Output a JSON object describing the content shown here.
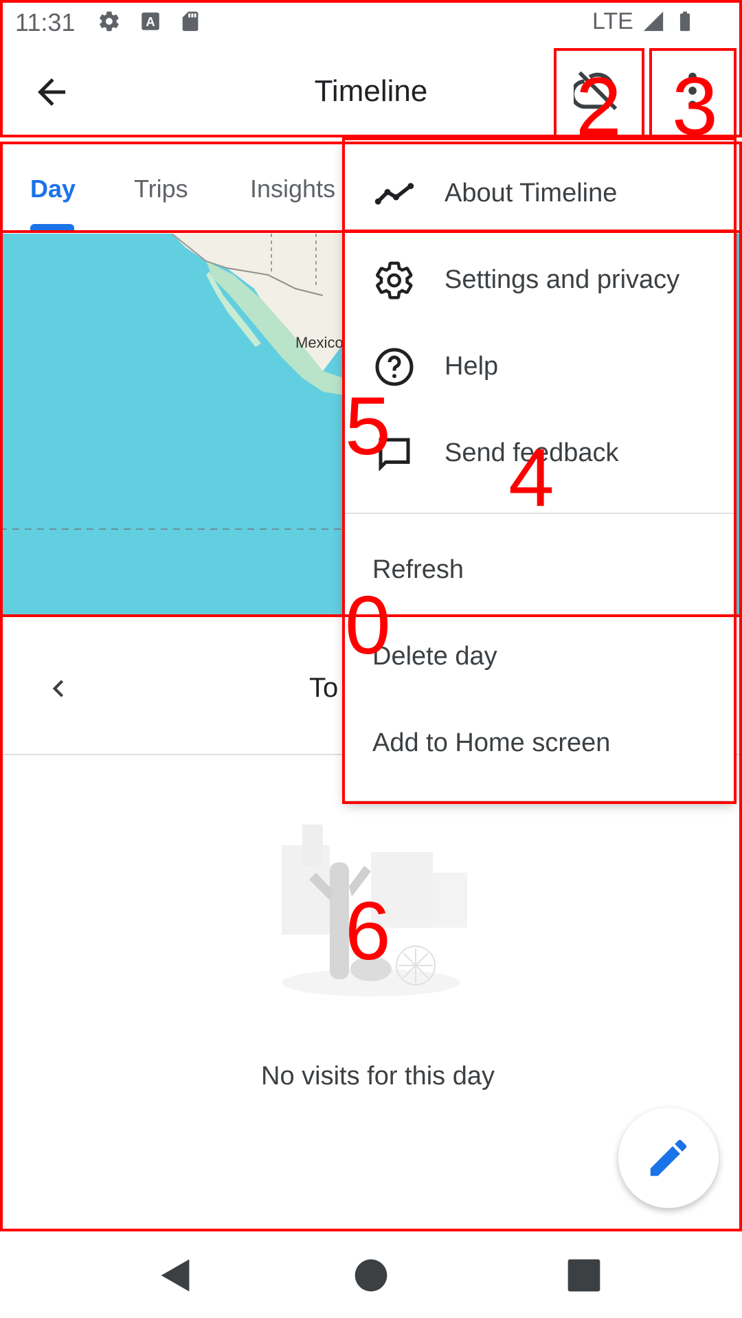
{
  "status_bar": {
    "time": "11:31",
    "network": "LTE"
  },
  "app_bar": {
    "title": "Timeline"
  },
  "tabs": [
    {
      "label": "Day",
      "active": true
    },
    {
      "label": "Trips",
      "active": false
    },
    {
      "label": "Insights",
      "active": false
    }
  ],
  "map": {
    "place_label": "Mexico"
  },
  "date_nav": {
    "label": "To"
  },
  "empty_state": {
    "message": "No visits for this day"
  },
  "menu": {
    "items": [
      {
        "label": "About Timeline",
        "icon": "timeline-trend-icon"
      },
      {
        "label": "Settings and privacy",
        "icon": "gear-icon"
      },
      {
        "label": "Help",
        "icon": "help-circle-icon"
      },
      {
        "label": "Send feedback",
        "icon": "feedback-icon"
      },
      {
        "label": "Refresh",
        "icon": null
      },
      {
        "label": "Delete day",
        "icon": null
      },
      {
        "label": "Add to Home screen",
        "icon": null
      }
    ]
  },
  "annotations": [
    "0",
    "2",
    "3",
    "4",
    "5",
    "6"
  ],
  "colors": {
    "accent": "#1a73e8",
    "water": "#62cfe0",
    "annotation": "#ff0000"
  }
}
